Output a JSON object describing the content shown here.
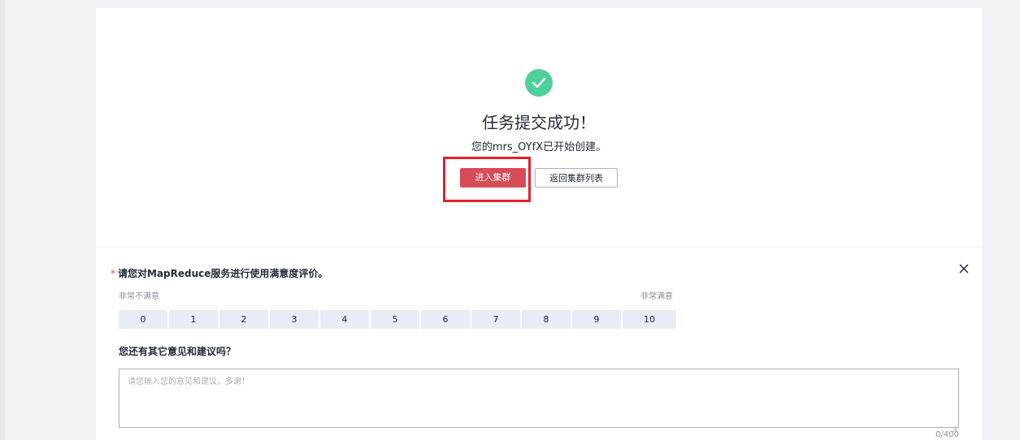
{
  "success": {
    "icon": "check-circle-icon",
    "title": "任务提交成功！",
    "description": "您的mrs_OYfX已开始创建。",
    "primary_button": "进入集群",
    "secondary_button": "返回集群列表"
  },
  "survey": {
    "required_mark": "*",
    "question": "请您对MapReduce服务进行使用满意度评价。",
    "scale_low_label": "非常不满意",
    "scale_high_label": "非常满意",
    "scale": [
      "0",
      "1",
      "2",
      "3",
      "4",
      "5",
      "6",
      "7",
      "8",
      "9",
      "10"
    ],
    "feedback_question": "您还有其它意见和建议吗？",
    "feedback_value": "",
    "feedback_placeholder": "请您输入您的意见和建议，多谢！",
    "counter": "0/400"
  },
  "colors": {
    "success": "#4fcf9c",
    "primary": "#d64c57",
    "highlight": "#e1212b",
    "scale_bg": "#e8ecf7"
  }
}
